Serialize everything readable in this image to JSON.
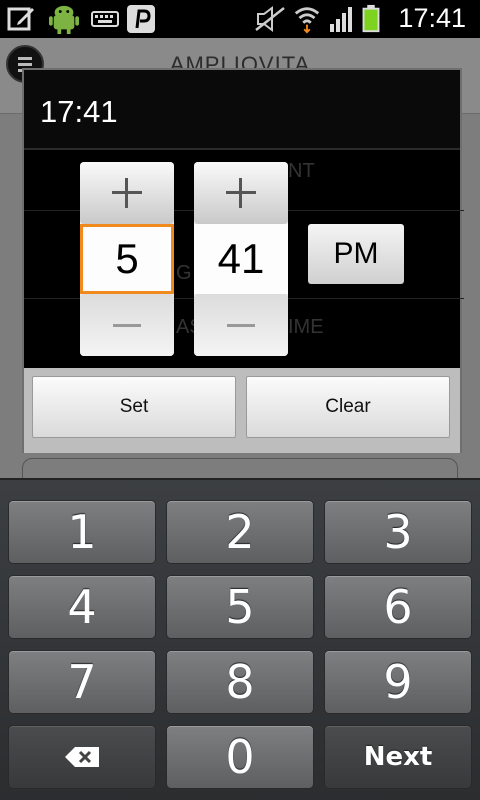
{
  "status_bar": {
    "clock": "17:41",
    "icons": [
      "edit-icon",
      "android-debug-icon",
      "keyboard-icon",
      "pinterest-icon",
      "mute-icon",
      "wifi-icon",
      "signal-icon",
      "battery-icon"
    ]
  },
  "app": {
    "title": "AMPLIOVITA",
    "ghost_labels": [
      "NT",
      "G",
      "AST",
      "IME"
    ]
  },
  "dialog": {
    "title": "17:41",
    "hour": "5",
    "minute": "41",
    "ampm": "PM",
    "set_label": "Set",
    "clear_label": "Clear"
  },
  "keyboard": {
    "keys": [
      "1",
      "2",
      "3",
      "4",
      "5",
      "6",
      "7",
      "8",
      "9",
      "0"
    ],
    "next_label": "Next"
  },
  "colors": {
    "focus_accent": "#f08a1c",
    "battery_green": "#7ed321"
  }
}
